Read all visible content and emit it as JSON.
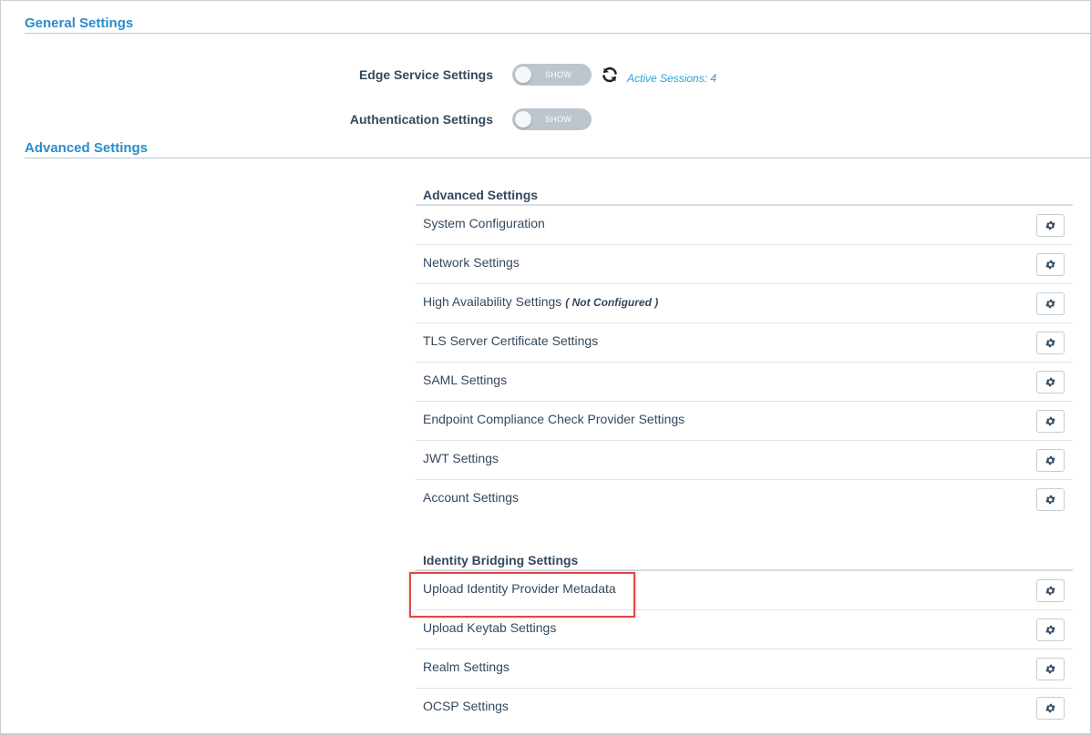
{
  "general": {
    "header": "General Settings",
    "edge": {
      "label": "Edge Service Settings",
      "toggle_text": "SHOW",
      "sessions": "Active Sessions: 4"
    },
    "auth": {
      "label": "Authentication Settings",
      "toggle_text": "SHOW"
    }
  },
  "advanced": {
    "header": "Advanced Settings",
    "panel_title": "Advanced Settings",
    "items": [
      {
        "label": "System Configuration"
      },
      {
        "label": "Network Settings"
      },
      {
        "label": "High Availability Settings",
        "note": "( Not Configured )"
      },
      {
        "label": "TLS Server Certificate Settings"
      },
      {
        "label": "SAML Settings"
      },
      {
        "label": "Endpoint Compliance Check Provider Settings"
      },
      {
        "label": "JWT Settings"
      },
      {
        "label": "Account Settings"
      }
    ]
  },
  "identity": {
    "panel_title": "Identity Bridging Settings",
    "items": [
      {
        "label": "Upload Identity Provider Metadata"
      },
      {
        "label": "Upload Keytab Settings"
      },
      {
        "label": "Realm Settings"
      },
      {
        "label": "OCSP Settings"
      }
    ]
  },
  "colors": {
    "accent": "#2a8ccc",
    "highlight": "#e04848",
    "toggle_off": "#bcc6cf"
  },
  "icons": {
    "gear": "gear-icon",
    "refresh": "refresh-icon"
  }
}
